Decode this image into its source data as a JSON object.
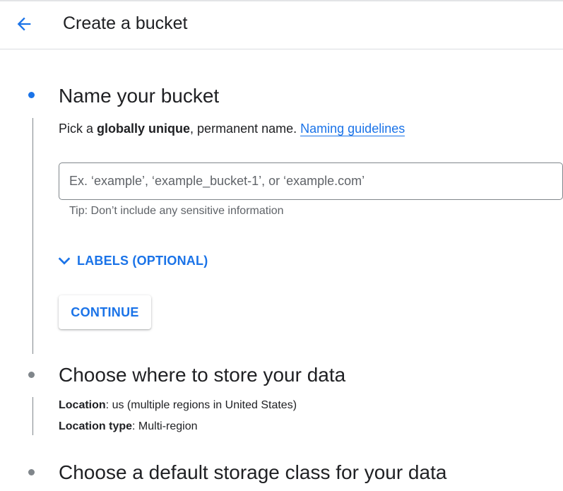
{
  "header": {
    "title": "Create a bucket",
    "back_icon": "arrow-back-icon"
  },
  "colors": {
    "accent": "#1a73e8",
    "active_dot": "#1a73e8",
    "inactive_dot": "#80868b",
    "text": "#202124",
    "muted": "#5f6368"
  },
  "steps": [
    {
      "title": "Name your bucket",
      "description": {
        "before": "Pick a ",
        "bold": "globally unique",
        "after": ", permanent name. ",
        "link": "Naming guidelines"
      },
      "input": {
        "value": "",
        "placeholder": "Ex. ‘example’, ‘example_bucket-1’, or ‘example.com’"
      },
      "tip": "Tip: Don’t include any sensitive information",
      "labels_toggle": "LABELS (OPTIONAL)",
      "continue_label": "CONTINUE"
    },
    {
      "title": "Choose where to store your data",
      "location_key": "Location",
      "location_value": ": us (multiple regions in United States)",
      "location_type_key": "Location type",
      "location_type_value": ": Multi-region"
    },
    {
      "title": "Choose a default storage class for your data"
    }
  ]
}
